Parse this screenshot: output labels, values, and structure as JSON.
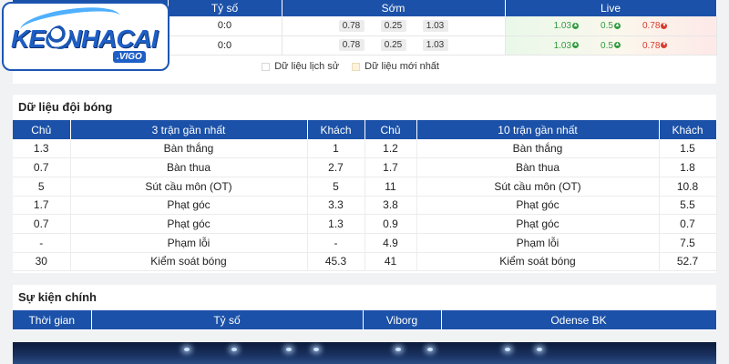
{
  "odds": {
    "headers": [
      "",
      "Tỷ số",
      "Sớm",
      "Live"
    ],
    "rows": [
      {
        "score": "0:0",
        "early": [
          "0.78",
          "0.25",
          "1.03"
        ],
        "live": [
          {
            "v": "1.03",
            "dir": "up"
          },
          {
            "v": "0.5",
            "dir": "up"
          },
          {
            "v": "0.78",
            "dir": "down"
          }
        ]
      },
      {
        "score": "0:0",
        "early": [
          "0.78",
          "0.25",
          "1.03"
        ],
        "live": [
          {
            "v": "1.03",
            "dir": "up"
          },
          {
            "v": "0.5",
            "dir": "up"
          },
          {
            "v": "0.78",
            "dir": "down"
          }
        ]
      }
    ],
    "legend_history": "Dữ liệu lịch sử",
    "legend_latest": "Dữ liệu mới nhất"
  },
  "logo": {
    "brand": "KEONHACAI",
    "sub": ".VIGO"
  },
  "team_data": {
    "title": "Dữ liệu đội bóng",
    "headers": [
      "Chủ",
      "3 trận gần nhất",
      "Khách",
      "Chủ",
      "10 trận gần nhất",
      "Khách"
    ],
    "rows": [
      [
        "1.3",
        "Bàn thắng",
        "1",
        "1.2",
        "Bàn thắng",
        "1.5"
      ],
      [
        "0.7",
        "Bàn thua",
        "2.7",
        "1.7",
        "Bàn thua",
        "1.8"
      ],
      [
        "5",
        "Sút cầu môn (OT)",
        "5",
        "11",
        "Sút cầu môn (OT)",
        "10.8"
      ],
      [
        "1.7",
        "Phạt góc",
        "3.3",
        "3.8",
        "Phạt góc",
        "5.5"
      ],
      [
        "0.7",
        "Phạt góc",
        "1.3",
        "0.9",
        "Phạt góc",
        "0.7"
      ],
      [
        "-",
        "Phạm lỗi",
        "-",
        "4.9",
        "Phạm lỗi",
        "7.5"
      ],
      [
        "30",
        "Kiểm soát bóng",
        "45.3",
        "41",
        "Kiểm soát bóng",
        "52.7"
      ]
    ]
  },
  "events": {
    "title": "Sự kiện chính",
    "headers": [
      "Thời gian",
      "Tỷ số",
      "Viborg",
      "Odense BK"
    ]
  },
  "colors": {
    "header_blue": "#1b51a8",
    "up_green": "#2f9c3f",
    "down_red": "#d73a2e"
  }
}
